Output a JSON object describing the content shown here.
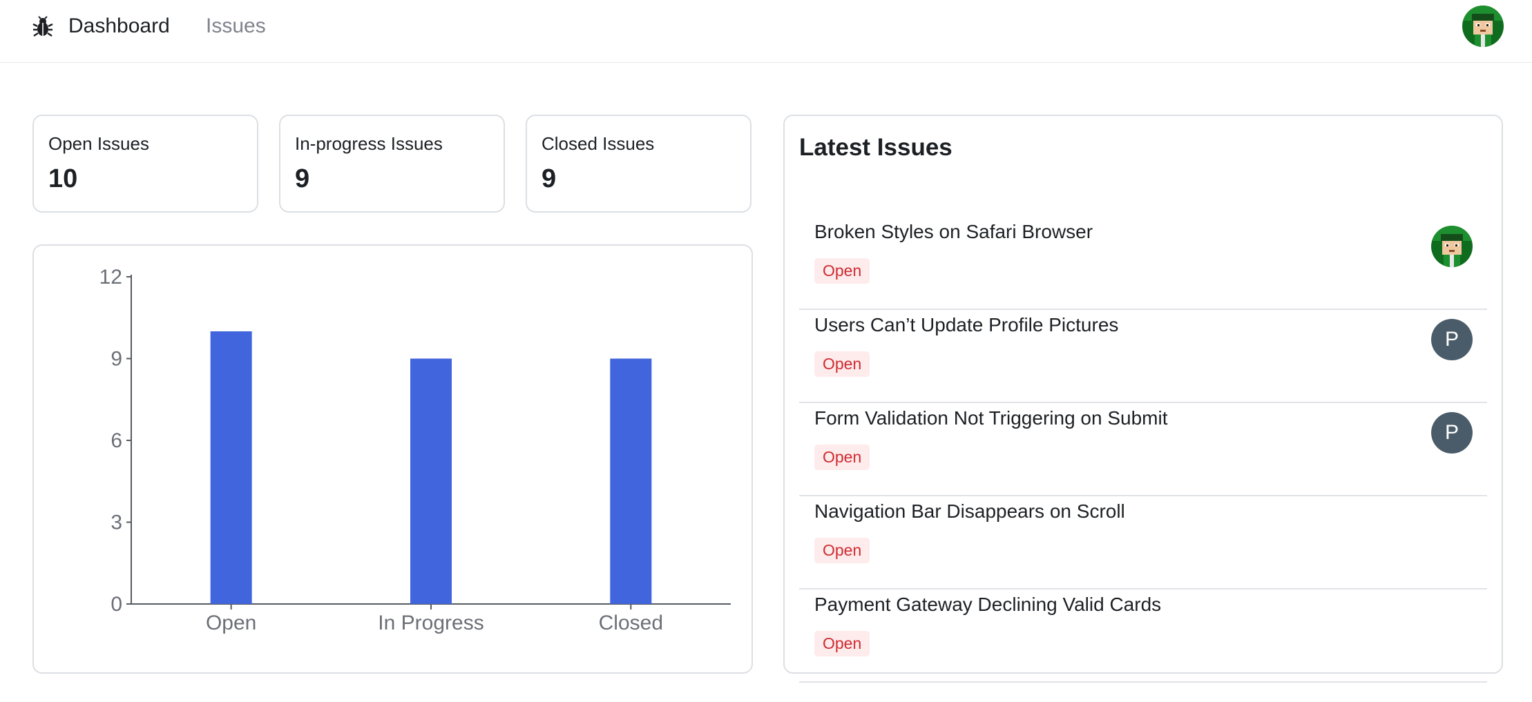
{
  "nav": {
    "logo_icon": "bug-icon",
    "dashboard_label": "Dashboard",
    "issues_label": "Issues",
    "user_avatar": "avatar-image"
  },
  "stats": [
    {
      "label": "Open Issues",
      "value": "10"
    },
    {
      "label": "In-progress Issues",
      "value": "9"
    },
    {
      "label": "Closed Issues",
      "value": "9"
    }
  ],
  "latest": {
    "title": "Latest Issues",
    "issues": [
      {
        "title": "Broken Styles on Safari Browser",
        "status": "Open",
        "assignee": "image"
      },
      {
        "title": "Users Can’t Update Profile Pictures",
        "status": "Open",
        "assignee": "P"
      },
      {
        "title": "Form Validation Not Triggering on Submit",
        "status": "Open",
        "assignee": "P"
      },
      {
        "title": "Navigation Bar Disappears on Scroll",
        "status": "Open",
        "assignee": ""
      },
      {
        "title": "Payment Gateway Declining Valid Cards",
        "status": "Open",
        "assignee": ""
      }
    ]
  },
  "colors": {
    "bar": "#4065dd",
    "badge_bg": "#feebec",
    "badge_text": "#ce2c31",
    "avatar_bg": "#4a5c6a"
  },
  "chart_data": {
    "type": "bar",
    "categories": [
      "Open",
      "In Progress",
      "Closed"
    ],
    "values": [
      10,
      9,
      9
    ],
    "yticks": [
      "0",
      "3",
      "6",
      "9",
      "12"
    ],
    "ylim": [
      0,
      12
    ],
    "title": "",
    "xlabel": "",
    "ylabel": "",
    "grid": false
  }
}
